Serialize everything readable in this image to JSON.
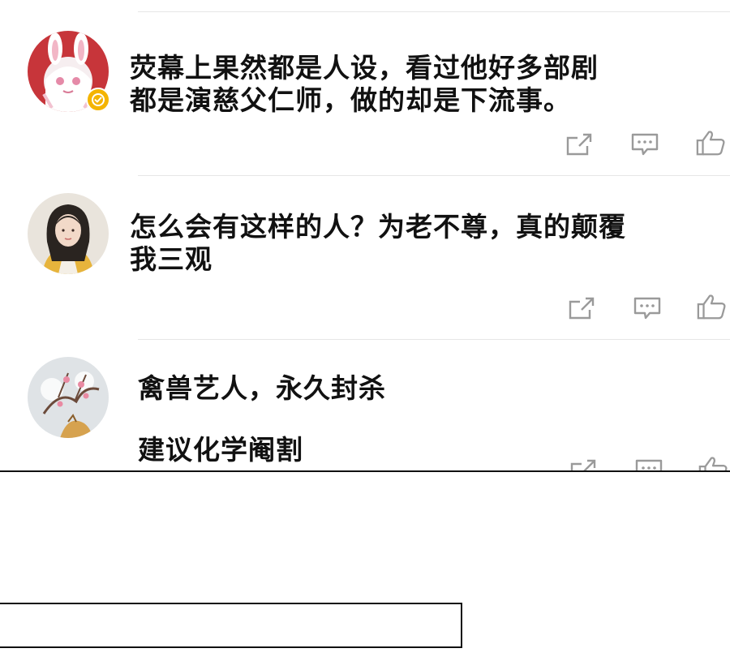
{
  "comments": [
    {
      "text": "荧幕上果然都是人设，看过他好多部剧\n都是演慈父仁师，做的却是下流事。",
      "verified": true
    },
    {
      "text": "怎么会有这样的人？为老不尊，真的颠覆\n我三观",
      "verified": false
    },
    {
      "text": "禽兽艺人，永久封杀\n\n建议化学阉割",
      "verified": false
    }
  ],
  "actions": {
    "share": "share-icon",
    "reply": "comment-icon",
    "like": "thumbs-up-icon"
  },
  "colors": {
    "text": "#111111",
    "icon": "#9a9a9a",
    "divider": "#e6e6e6",
    "verified_badge": "#f4b400"
  }
}
